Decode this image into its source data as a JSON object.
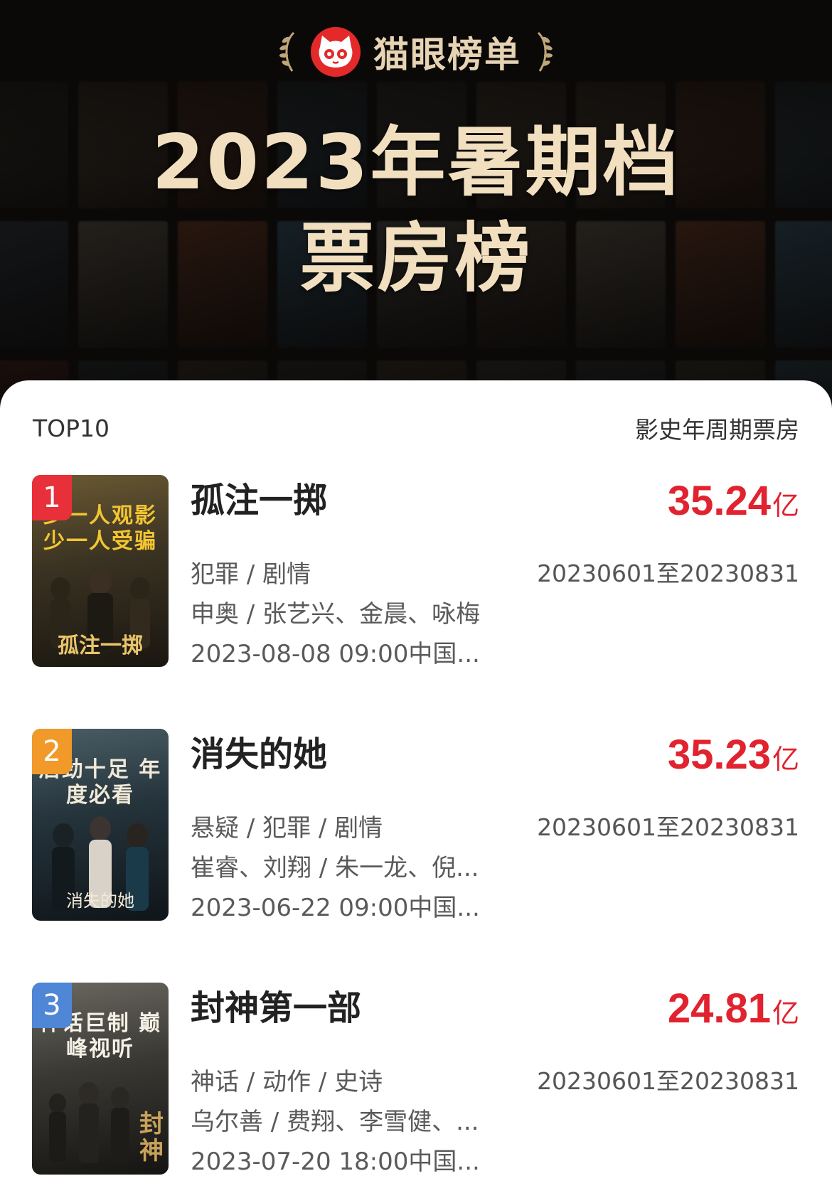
{
  "header": {
    "brand": "猫眼榜单",
    "title_line1": "2023年暑期档",
    "title_line2": "票房榜"
  },
  "list": {
    "left_label": "TOP10",
    "right_label": "影史年周期票房",
    "unit": "亿",
    "items": [
      {
        "rank": "1",
        "title": "孤注一掷",
        "genres": "犯罪 / 剧情",
        "people": "申奥 / 张艺兴、金晨、咏梅",
        "release": "2023-08-08 09:00中国...",
        "gross": "35.24",
        "period": "20230601至20230831",
        "rank_color": "#e8303a"
      },
      {
        "rank": "2",
        "title": "消失的她",
        "genres": "悬疑 / 犯罪 / 剧情",
        "people": "崔睿、刘翔 / 朱一龙、倪...",
        "release": "2023-06-22 09:00中国...",
        "gross": "35.23",
        "period": "20230601至20230831",
        "rank_color": "#f19a2a"
      },
      {
        "rank": "3",
        "title": "封神第一部",
        "genres": "神话 / 动作 / 史诗",
        "people": "乌尔善 / 费翔、李雪健、...",
        "release": "2023-07-20 18:00中国...",
        "gross": "24.81",
        "period": "20230601至20230831",
        "rank_color": "#4f86d6"
      }
    ]
  },
  "posters": [
    {
      "tag": "少一人观影 少一人受骗",
      "palette": [
        "#5a4a2a",
        "#1e1a12"
      ],
      "tag_color": "#f2c531"
    },
    {
      "tag": "后劲十足 年度必看",
      "palette": [
        "#3a4a52",
        "#0f1519"
      ],
      "tag_color": "#f1ead8"
    },
    {
      "tag": "神话巨制 巅峰视听",
      "palette": [
        "#4a4842",
        "#151412"
      ],
      "tag_color": "#f4f0e6"
    }
  ],
  "colors": {
    "accent_red": "#e1222f",
    "brand_red": "#e4292b",
    "title_gold": "#f1dfbf"
  }
}
